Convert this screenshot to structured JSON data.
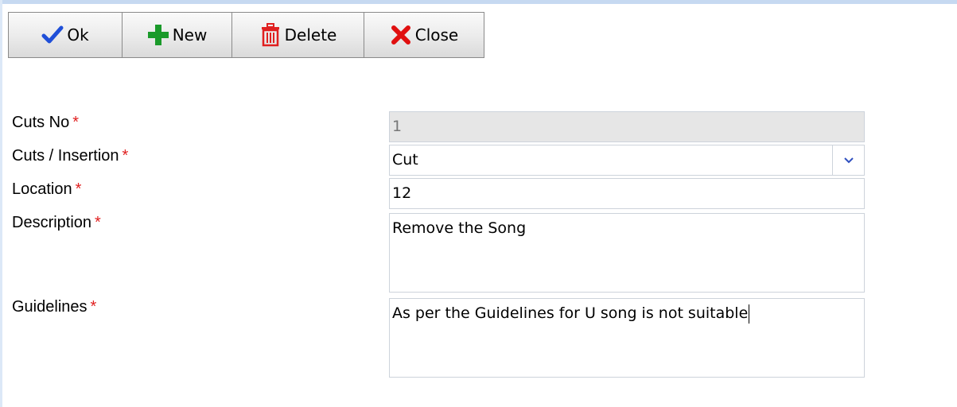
{
  "toolbar": {
    "ok_label": "Ok",
    "new_label": "New",
    "delete_label": "Delete",
    "close_label": "Close"
  },
  "form": {
    "required_mark": "*",
    "cuts_no": {
      "label": "Cuts No",
      "value": "1"
    },
    "cuts_insertion": {
      "label": "Cuts / Insertion",
      "value": "Cut"
    },
    "location": {
      "label": "Location",
      "value": "12"
    },
    "description": {
      "label": "Description",
      "value": "Remove the Song"
    },
    "guidelines": {
      "label": "Guidelines",
      "value": "As per the Guidelines for U song is not suitable"
    }
  },
  "colors": {
    "ok_icon": "#1f4fd8",
    "new_icon": "#1a9a2a",
    "delete_icon": "#e02020",
    "close_icon": "#e01010",
    "required": "#e02020",
    "readonly_bg": "#e6e6e6"
  },
  "icons": {
    "ok": "checkmark-icon",
    "new": "plus-icon",
    "delete": "trash-icon",
    "close": "x-icon",
    "select": "chevron-down-icon"
  }
}
